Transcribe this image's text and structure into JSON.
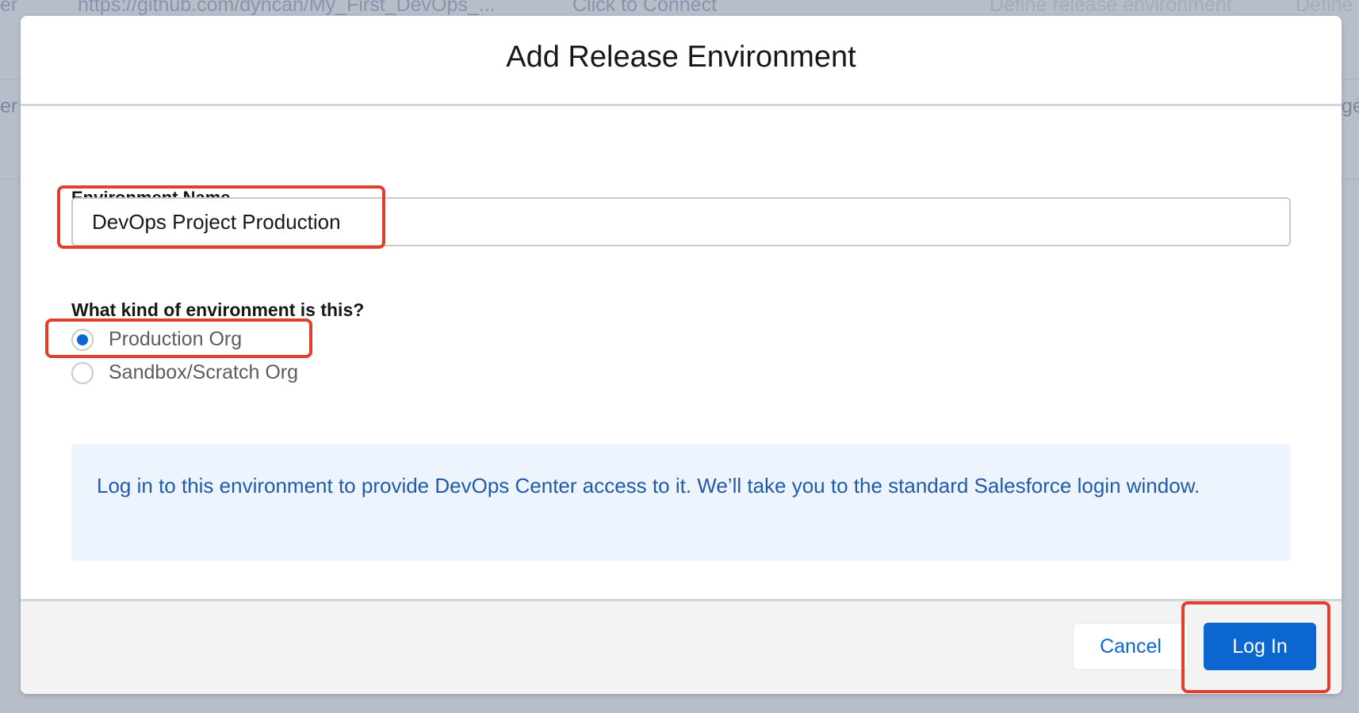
{
  "background": {
    "row1": {
      "repo_url": "https://github.com/dyncan/My_First_DevOps_...",
      "connect_link": "Click to Connect",
      "define_env": "Define release environment",
      "define_cut": "Define"
    },
    "left_fragment_top": "er",
    "left_fragment_mid": "er",
    "right_fragment_mid": "ge"
  },
  "modal": {
    "title": "Add Release Environment",
    "environment_name": {
      "label": "Environment Name",
      "value": "DevOps Project Production"
    },
    "environment_type": {
      "label": "What kind of environment is this?",
      "options": [
        {
          "label": "Production Org",
          "selected": true
        },
        {
          "label": "Sandbox/Scratch Org",
          "selected": false
        }
      ]
    },
    "info_text": "Log in to this environment to provide DevOps Center access to it. We’ll take you to the standard Salesforce login window.",
    "footer": {
      "cancel_label": "Cancel",
      "login_label": "Log In"
    }
  },
  "colors": {
    "brand_blue": "#0b66cf",
    "info_bg": "#eef4fd",
    "info_text": "#1f5ba8",
    "annotation_red": "#e0402b",
    "overlay": "#b7bec9"
  }
}
